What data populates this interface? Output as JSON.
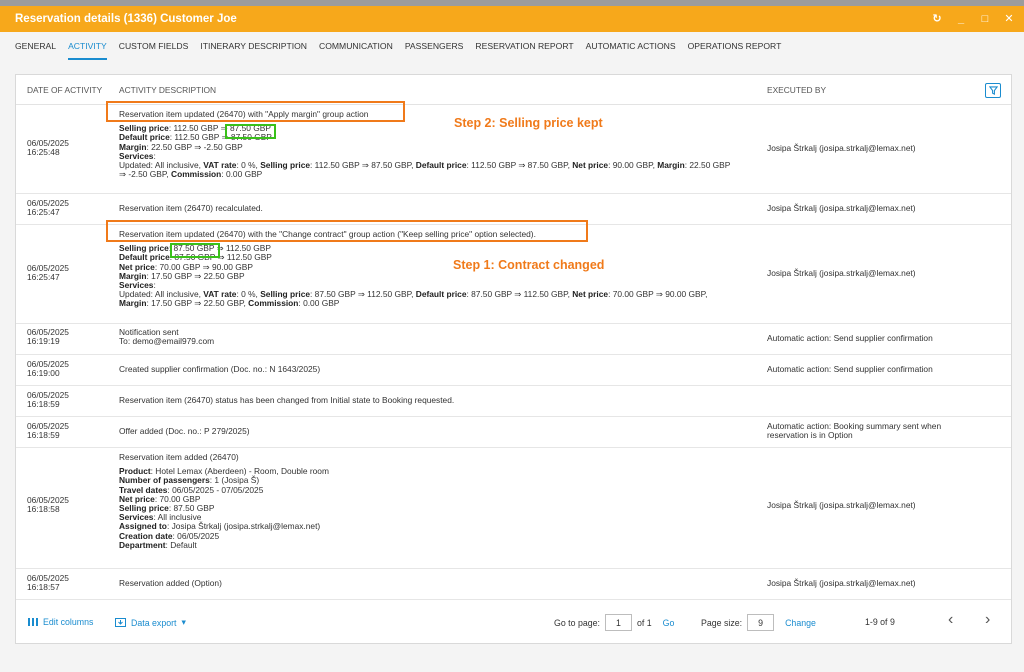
{
  "window": {
    "title": "Reservation details (1336) Customer Joe",
    "controls": [
      "↻",
      "_",
      "□",
      "✕"
    ]
  },
  "tabs": [
    {
      "label": "GENERAL",
      "active": false
    },
    {
      "label": "ACTIVITY",
      "active": true
    },
    {
      "label": "CUSTOM FIELDS",
      "active": false
    },
    {
      "label": "ITINERARY DESCRIPTION",
      "active": false
    },
    {
      "label": "COMMUNICATION",
      "active": false
    },
    {
      "label": "PASSENGERS",
      "active": false
    },
    {
      "label": "RESERVATION REPORT",
      "active": false
    },
    {
      "label": "AUTOMATIC ACTIONS",
      "active": false
    },
    {
      "label": "OPERATIONS REPORT",
      "active": false
    }
  ],
  "table": {
    "headers": {
      "date": "DATE OF ACTIVITY",
      "description": "ACTIVITY DESCRIPTION",
      "executed_by": "EXECUTED BY"
    },
    "rows": [
      {
        "date": "06/05/2025",
        "time": "16:25:48",
        "executed_by": "Josipa Štrkalj (josipa.strkalj@lemax.net)",
        "lines": [
          "Reservation item updated (26470) with \"Apply margin\" group action",
          "",
          "<b>Selling price</b>: 112.50 GBP ⇒ 87.50 GBP",
          "<b>Default price</b>: 112.50 GBP ⇒ 87.50 GBP",
          "<b>Margin</b>: 22.50 GBP ⇒ -2.50 GBP",
          "<b>Services</b>:",
          "Updated: All inclusive, <b>VAT rate</b>: 0 %, <b>Selling price</b>: 112.50 GBP ⇒ 87.50 GBP, <b>Default price</b>: 112.50 GBP ⇒ 87.50 GBP, <b>Net price</b>: 90.00 GBP, <b>Margin</b>: 22.50 GBP",
          "⇒ -2.50 GBP, <b>Commission</b>: 0.00 GBP"
        ]
      },
      {
        "date": "06/05/2025",
        "time": "16:25:47",
        "executed_by": "Josipa Štrkalj (josipa.strkalj@lemax.net)",
        "lines": [
          "Reservation item (26470) recalculated."
        ]
      },
      {
        "date": "06/05/2025",
        "time": "16:25:47",
        "executed_by": "Josipa Štrkalj (josipa.strkalj@lemax.net)",
        "lines": [
          "Reservation item updated (26470) with the \"Change contract\" group action (\"Keep selling price\" option selected).",
          "",
          "<b>Selling price</b>: 87.50 GBP ⇒ 112.50 GBP",
          "<b>Default price</b>: 87.50 GBP ⇒ 112.50 GBP",
          "<b>Net price</b>: 70.00 GBP ⇒ 90.00 GBP",
          "<b>Margin</b>: 17.50 GBP ⇒ 22.50 GBP",
          "<b>Services</b>:",
          "Updated: All inclusive, <b>VAT rate</b>: 0 %, <b>Selling price</b>: 87.50 GBP ⇒ 112.50 GBP, <b>Default price</b>: 87.50 GBP ⇒ 112.50 GBP, <b>Net price</b>: 70.00 GBP ⇒ 90.00 GBP,",
          "<b>Margin</b>: 17.50 GBP ⇒ 22.50 GBP, <b>Commission</b>: 0.00 GBP"
        ]
      },
      {
        "date": "06/05/2025",
        "time": "16:19:19",
        "executed_by": "Automatic action: Send supplier confirmation",
        "lines": [
          "Notification sent",
          "To: demo@email979.com"
        ]
      },
      {
        "date": "06/05/2025",
        "time": "16:19:00",
        "executed_by": "Automatic action: Send supplier confirmation",
        "lines": [
          "Created supplier confirmation (Doc. no.: N 1643/2025)"
        ]
      },
      {
        "date": "06/05/2025",
        "time": "16:18:59",
        "executed_by": "",
        "lines": [
          "Reservation item (26470) status has been changed from Initial state to Booking requested."
        ]
      },
      {
        "date": "06/05/2025",
        "time": "16:18:59",
        "executed_by": "Automatic action: Booking summary sent when reservation is in Option",
        "lines": [
          "Offer added (Doc. no.: P 279/2025)"
        ]
      },
      {
        "date": "06/05/2025",
        "time": "16:18:58",
        "executed_by": "Josipa Štrkalj (josipa.strkalj@lemax.net)",
        "lines": [
          "Reservation item added (26470)",
          "",
          "<b>Product</b>: Hotel Lemax (Aberdeen) - Room, Double room",
          "<b>Number of passengers</b>: 1 (Josipa Š)",
          "<b>Travel dates</b>: 06/05/2025 - 07/05/2025",
          "<b>Net price</b>: 70.00 GBP",
          "<b>Selling price</b>: 87.50 GBP",
          "<b>Services</b>: All inclusive",
          "<b>Assigned to</b>: Josipa Štrkalj (josipa.strkalj@lemax.net)",
          "<b>Creation date</b>: 06/05/2025",
          "<b>Department</b>: Default"
        ]
      },
      {
        "date": "06/05/2025",
        "time": "16:18:57",
        "executed_by": "Josipa Štrkalj (josipa.strkalj@lemax.net)",
        "lines": [
          "Reservation added (Option)"
        ]
      }
    ]
  },
  "annotations": {
    "step2": "Step 2: Selling price kept",
    "step1": "Step 1: Contract changed"
  },
  "footer": {
    "edit_columns": "Edit columns",
    "data_export": "Data export",
    "go_to_page_label": "Go to page:",
    "page_value": "1",
    "of_pages": "of 1",
    "go": "Go",
    "page_size_label": "Page size:",
    "page_size_value": "9",
    "change": "Change",
    "range": "1-9 of 9"
  },
  "colors": {
    "accent": "#f7a81b",
    "link": "#1a8ccf",
    "annotation": "#f07a1a",
    "highlight": "#39c01a"
  }
}
